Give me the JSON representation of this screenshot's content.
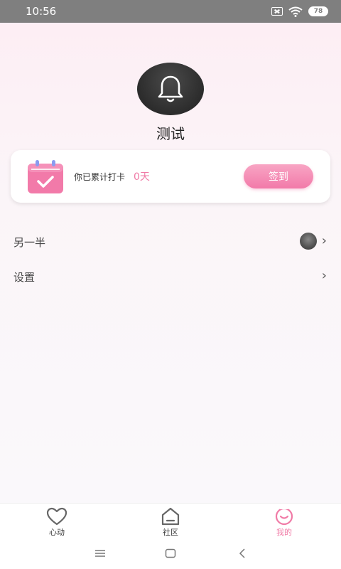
{
  "status_bar": {
    "time": "10:56",
    "battery": "78"
  },
  "profile": {
    "name": "测试",
    "avatar_icon": "bell-icon"
  },
  "checkin": {
    "text": "你已累计打卡",
    "days": "0天",
    "button_label": "签到",
    "icon": "calendar-check-icon"
  },
  "menu": {
    "partner_label": "另一半",
    "settings_label": "设置"
  },
  "tabs": [
    {
      "label": "心动",
      "icon": "heart-icon",
      "active": false
    },
    {
      "label": "社区",
      "icon": "home-icon",
      "active": false
    },
    {
      "label": "我的",
      "icon": "smile-icon",
      "active": true
    }
  ],
  "colors": {
    "accent": "#f07aa6",
    "status_bar": "#7f7f7f"
  }
}
